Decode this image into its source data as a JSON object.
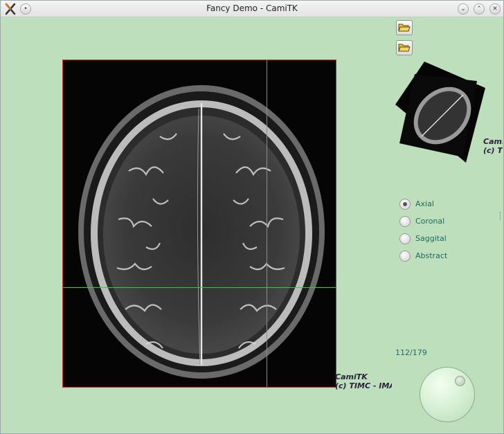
{
  "window": {
    "title": "Fancy Demo - CamiTK"
  },
  "toolbar": {
    "open_buttons": [
      {
        "icon": "folder-open-icon"
      },
      {
        "icon": "folder-open-icon"
      }
    ]
  },
  "viewer": {
    "watermark_line1": "CamiTK",
    "watermark_line2": "(c) TIMC - IMAG"
  },
  "thumbnail": {
    "watermark_line1": "CamiTK",
    "watermark_line2": "(c) TIMC - IMAG"
  },
  "orientation": {
    "options": [
      {
        "label": "Axial",
        "checked": true
      },
      {
        "label": "Coronal",
        "checked": false
      },
      {
        "label": "Saggital",
        "checked": false
      },
      {
        "label": "Abstract",
        "checked": false
      }
    ]
  },
  "slice": {
    "counter": "112/179",
    "current": 112,
    "total": 179
  },
  "colors": {
    "background": "#bddfbb",
    "crosshair": "#19e019",
    "viewer_border": "#dd2233",
    "label": "#1e6b61"
  }
}
